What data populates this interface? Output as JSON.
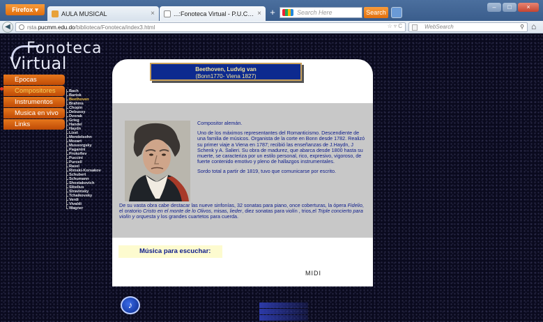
{
  "browser": {
    "app_button": "Firefox",
    "tabs": [
      {
        "label": "AULA MUSICAL",
        "active": false
      },
      {
        "label": "...:Fonoteca Virtual - P.U.C.M.M.:...",
        "active": true
      }
    ],
    "search_placeholder": "Search Here",
    "search_button": "Search",
    "url_prefix": "rsta.",
    "url_host": "pucmm.edu.do",
    "url_path": "/biblioteca/Fonoteca/index3.html",
    "web_search_placeholder": "WebSearch"
  },
  "site": {
    "logo_line1": "Fonoteca",
    "logo_line2": "Virtual",
    "menu": [
      {
        "label": "Epocas",
        "active": false
      },
      {
        "label": "Compositores",
        "active": true
      },
      {
        "label": "Instrumentos",
        "active": false
      },
      {
        "label": "Musica en vivo",
        "active": false
      },
      {
        "label": "Links",
        "active": false
      }
    ],
    "composers": [
      "Bach",
      "Bartok",
      "Beethoven",
      "Brahms",
      "Chopin",
      "Debussy",
      "Dvorak",
      "Grieg",
      "Handel",
      "Haydn",
      "Lizst",
      "Mendelsohn",
      "Mozart",
      "Mussorgsky",
      "Paganini",
      "Prokofiev",
      "Puccini",
      "Purcell",
      "Ravel",
      "Rimski-Korsakov",
      "Schubert",
      "Schumann",
      "Shostakovich",
      "Sibelius",
      "Stravinsky",
      "Tchaikovsky",
      "Verdi",
      "Vivaldi",
      "Wagner"
    ],
    "active_composer": "Beethoven"
  },
  "composer": {
    "name": "Beethoven, Ludvig van",
    "dates": "(Bonn1770-  Viena 1827)",
    "bio_p1": "Compositor alemán.",
    "bio_p2": "Uno de los máximos representantes del Romanticismo. Descendiente de una familia de músicos. Organista de la corte en Bonn desde 1782. Realizó su primer viaje a Viena en 1787; recibió las enseñanzas de J.Haydn, J Schenk y A. Salieri. Su obra de madurez, que abarca desde 1800 hasta su muerte, se caracteriza por un estilo personal, rico, expresivo, vigoroso, de fuerte contenido emotivo y pleno de hallazgos instrumentales.",
    "bio_p3": "Sordo total a partir de 1819, tuvo que comunicarse por escrito.",
    "works_a": "De su vasta obra cabe destacar las nueve sinfonías, 32 sonatas para piano, once coberturas, la ópera",
    "works_fidelio": "Fidelio",
    "works_b": ", el oratorio",
    "works_cristo": "Cristo en el monte de lo Olivos",
    "works_c": ", misas,",
    "works_lieder": "lieder",
    "works_d": ", diez sonatas para violín , trios,el",
    "works_triple": "Triple concierto para violín y orquesta",
    "works_e": "y los grandes cuartetos para cuerda."
  },
  "listen_label": "Música para escuchar:",
  "midi_label": "MIDI",
  "icons": {
    "music_note": "♪"
  }
}
